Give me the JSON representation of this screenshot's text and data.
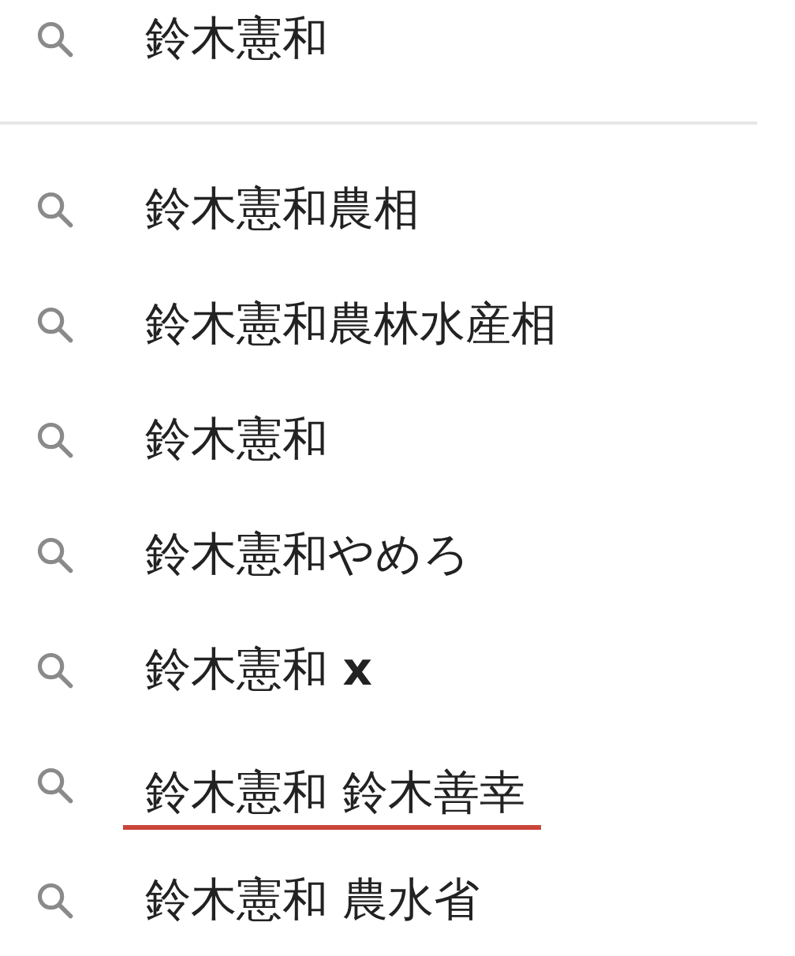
{
  "search": {
    "value": "鈴木憲和"
  },
  "suggestions": [
    {
      "text": "鈴木憲和農相",
      "underlined": false
    },
    {
      "text": "鈴木憲和農林水産相",
      "underlined": false
    },
    {
      "text": "鈴木憲和",
      "underlined": false
    },
    {
      "text": "鈴木憲和やめろ",
      "underlined": false
    },
    {
      "text": "鈴木憲和 **x**",
      "underlined": false
    },
    {
      "text": "鈴木憲和 鈴木善幸",
      "underlined": true
    },
    {
      "text": "鈴木憲和 農水省",
      "underlined": false
    }
  ]
}
